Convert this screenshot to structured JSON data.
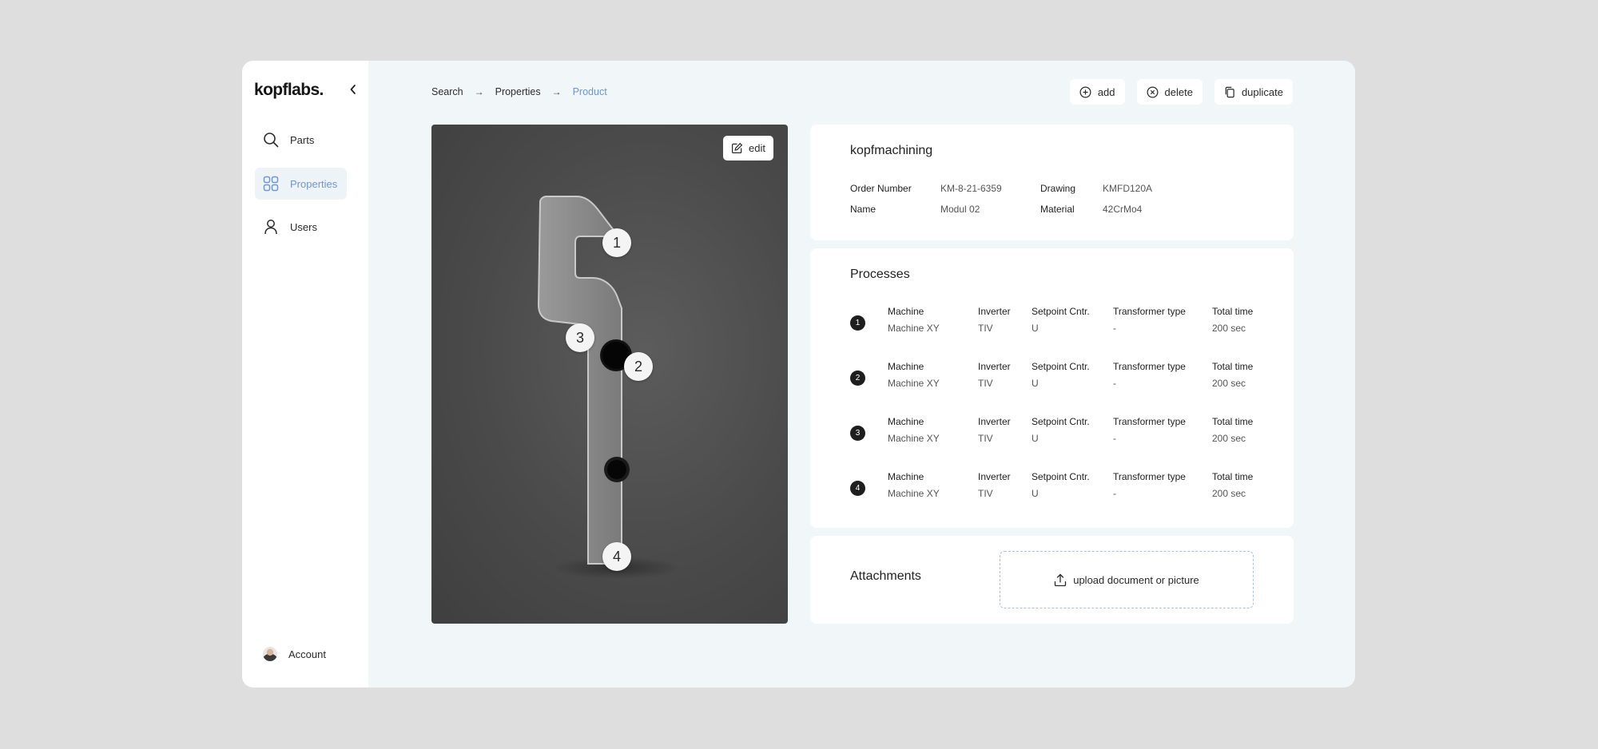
{
  "brand": {
    "logo": "kopflabs."
  },
  "sidebar": {
    "items": [
      {
        "label": "Parts",
        "icon": "search-icon"
      },
      {
        "label": "Properties",
        "icon": "grid-icon",
        "active": true
      },
      {
        "label": "Users",
        "icon": "user-icon"
      }
    ],
    "account": {
      "label": "Account"
    }
  },
  "breadcrumb": {
    "items": [
      "Search",
      "Properties",
      "Product"
    ]
  },
  "actions": {
    "add": "add",
    "delete": "delete",
    "duplicate": "duplicate"
  },
  "image": {
    "edit_label": "edit",
    "markers": [
      "1",
      "2",
      "3",
      "4"
    ]
  },
  "info": {
    "title": "kopfmachining",
    "order_number_label": "Order Number",
    "order_number": "KM-8-21-6359",
    "name_label": "Name",
    "name": "Modul 02",
    "drawing_label": "Drawing",
    "drawing": "KMFD120A",
    "material_label": "Material",
    "material": "42CrMo4"
  },
  "processes": {
    "title": "Processes",
    "headers": [
      "Machine",
      "Inverter",
      "Setpoint Cntr.",
      "Transformer type",
      "Total time"
    ],
    "rows": [
      {
        "num": "1",
        "values": [
          "Machine XY",
          "TIV",
          "U",
          "-",
          "200 sec"
        ]
      },
      {
        "num": "2",
        "values": [
          "Machine XY",
          "TIV",
          "U",
          "-",
          "200 sec"
        ]
      },
      {
        "num": "3",
        "values": [
          "Machine XY",
          "TIV",
          "U",
          "-",
          "200 sec"
        ]
      },
      {
        "num": "4",
        "values": [
          "Machine XY",
          "TIV",
          "U",
          "-",
          "200 sec"
        ]
      }
    ]
  },
  "attachments": {
    "title": "Attachments",
    "upload_label": "upload document or picture"
  },
  "colors": {
    "accent": "#6f96d3",
    "page_bg": "#dedede",
    "app_bg": "#f1f6f8"
  }
}
